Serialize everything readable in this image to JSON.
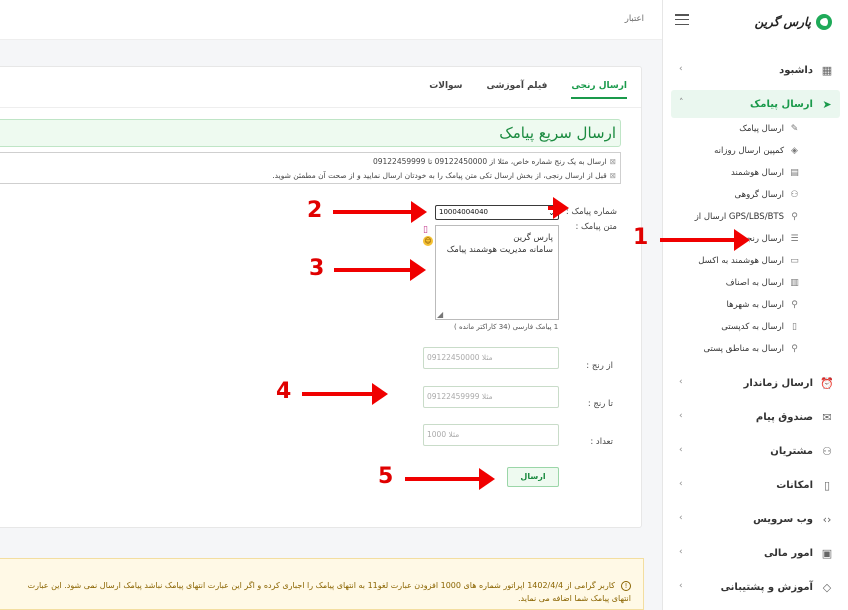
{
  "app": {
    "logo_text": "پارس گرین",
    "brand_color": "#1faa59"
  },
  "topbar": {
    "breadcrumb": "اعتبار"
  },
  "sidebar": {
    "items_top": [
      {
        "label": "داشبود",
        "icon": "dashboard-icon"
      },
      {
        "label": "ارسال پیامک",
        "icon": "send-icon",
        "active": true
      }
    ],
    "sub_items": [
      {
        "label": "ارسال پیامک",
        "icon": "edit-icon"
      },
      {
        "label": "کمپین ارسال روزانه",
        "icon": "layers-icon"
      },
      {
        "label": "ارسال هوشمند",
        "icon": "list-icon"
      },
      {
        "label": "ارسال گروهی",
        "icon": "group-icon"
      },
      {
        "label": "ارسال از GPS/LBS/BTS",
        "icon": "person-icon"
      },
      {
        "label": "ارسال رنجی",
        "icon": "range-list-icon"
      },
      {
        "label": "ارسال هوشمند به اکسل",
        "icon": "folder-icon"
      },
      {
        "label": "ارسال به اصناف",
        "icon": "building-icon"
      },
      {
        "label": "ارسال به شهرها",
        "icon": "person-icon"
      },
      {
        "label": "ارسال به کدپستی",
        "icon": "map-icon"
      },
      {
        "label": "ارسال به مناطق پستی",
        "icon": "person-icon"
      }
    ],
    "items_bottom": [
      {
        "label": "ارسال زماندار",
        "icon": "alarm-icon"
      },
      {
        "label": "صندوق پیام",
        "icon": "mail-icon"
      },
      {
        "label": "مشتریان",
        "icon": "users-icon"
      },
      {
        "label": "امکانات",
        "icon": "tablet-icon"
      },
      {
        "label": "وب سرویس",
        "icon": "code-icon"
      },
      {
        "label": "امور مالی",
        "icon": "wallet-icon"
      },
      {
        "label": "آموزش و پشتیبانی",
        "icon": "puzzle-icon"
      }
    ]
  },
  "main": {
    "tabs": [
      "ارسال رنجی",
      "فیلم آموزشی",
      "سوالات"
    ],
    "title": "ارسال سریع پیامک",
    "info_lines": [
      "ارسال به یک رنج شماره خاص، مثلا از 09122450000 تا 09122459999",
      "قبل از ارسال رنجی، از بخش ارسال تکی  متن پیامک را به خودتان ارسال نمایید و از صحت آن مطمئن شوید."
    ],
    "sender_label": "شماره پیامک :",
    "sender_value": "10004004040",
    "text_label": "متن پیامک :",
    "message_lines": [
      "پارس گرین",
      "سامانه مدیریت هوشمند پیامک"
    ],
    "counter": "1 پیامک فارسی (34 کاراکتر مانده )",
    "from_label": "از رنج :",
    "from_placeholder": "مثلا 09122450000",
    "to_label": "تا رنج :",
    "to_placeholder": "مثلا 09122459999",
    "count_label": "تعداد :",
    "count_placeholder": "مثلا 1000",
    "send_label": "ارسال"
  },
  "warning": {
    "text": "کاربر گرامی از 1402/4/4 اپراتور شماره های 1000 افزودن عبارت لغو11 به انتهای پیامک را اجباری کرده و اگر این عبارت انتهای پیامک نباشد پیامک ارسال نمی شود. این عبارت انتهای پیامک شما اضافه می نماید."
  },
  "annotations": [
    "1",
    "2",
    "3",
    "4",
    "5"
  ]
}
